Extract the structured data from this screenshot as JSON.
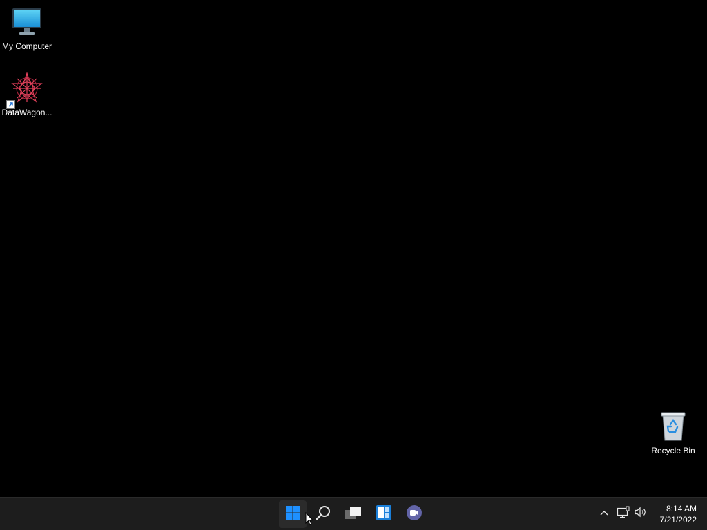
{
  "desktop": {
    "icons": [
      {
        "label": "My Computer",
        "icon": "monitor-icon"
      },
      {
        "label": "DataWagon...",
        "icon": "datawagon-app-icon",
        "shortcut": true
      },
      {
        "label": "Recycle Bin",
        "icon": "recycle-bin-icon"
      }
    ]
  },
  "taskbar": {
    "buttons": [
      {
        "name": "start",
        "icon": "windows-logo-icon"
      },
      {
        "name": "search",
        "icon": "search-icon"
      },
      {
        "name": "task-view",
        "icon": "task-view-icon"
      },
      {
        "name": "widgets",
        "icon": "widgets-icon"
      },
      {
        "name": "chat",
        "icon": "teams-chat-icon"
      }
    ],
    "tray": {
      "icons": [
        "chevron-up-icon",
        "network-icon",
        "volume-icon"
      ],
      "time": "8:14 AM",
      "date": "7/21/2022"
    }
  },
  "colors": {
    "background": "#000000",
    "taskbar": "#1d1d1d",
    "accent": "#0078d4"
  }
}
